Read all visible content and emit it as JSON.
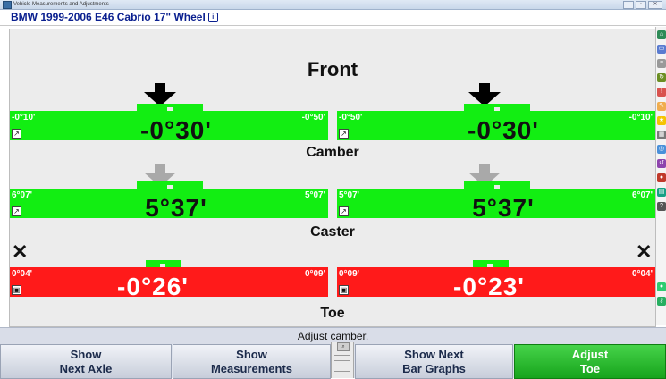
{
  "window": {
    "title": "Vehicle Measurements and Adjustments",
    "buttons": [
      "–",
      "▫",
      "✕"
    ]
  },
  "vehicle": {
    "title": "BMW 1999-2006 E46 Cabrio 17\" Wheel",
    "info_icon": "i"
  },
  "sections": {
    "front": "Front",
    "camber": "Camber",
    "caster": "Caster",
    "toe": "Toe"
  },
  "meters": {
    "camber_left": {
      "lim_left": "-0°10'",
      "lim_right": "-0°50'",
      "value": "-0°30'",
      "state": "in-spec",
      "color": "#12ee12"
    },
    "camber_right": {
      "lim_left": "-0°50'",
      "lim_right": "-0°10'",
      "value": "-0°30'",
      "state": "in-spec",
      "color": "#12ee12"
    },
    "caster_left": {
      "lim_left": "6°07'",
      "lim_right": "5°07'",
      "value": "5°37'",
      "state": "in-spec",
      "color": "#12ee12"
    },
    "caster_right": {
      "lim_left": "5°07'",
      "lim_right": "6°07'",
      "value": "5°37'",
      "state": "in-spec",
      "color": "#12ee12"
    },
    "toe_left": {
      "lim_left": "0°04'",
      "lim_right": "0°09'",
      "value": "-0°26'",
      "state": "out-of-spec",
      "color": "#ff1a1a"
    },
    "toe_right": {
      "lim_left": "0°09'",
      "lim_right": "0°04'",
      "value": "-0°23'",
      "state": "out-of-spec",
      "color": "#ff1a1a"
    }
  },
  "markers": {
    "toe_out_of_range": "✕",
    "wrench_icon": "wrench-icon",
    "lock_icon": "lock-icon"
  },
  "status": "Adjust camber.",
  "softkeys": [
    {
      "line1": "Show",
      "line2": "Next Axle",
      "active": false
    },
    {
      "line1": "Show",
      "line2": "Measurements",
      "active": false
    },
    {
      "line1": "Show Next",
      "line2": "Bar Graphs",
      "active": false
    },
    {
      "line1": "Adjust",
      "line2": "Toe",
      "active": true
    }
  ],
  "colors": {
    "in_spec": "#12ee12",
    "out_of_spec": "#ff1a1a",
    "active_button": "#17a41c",
    "vehicle_title": "#0a1f8f"
  }
}
